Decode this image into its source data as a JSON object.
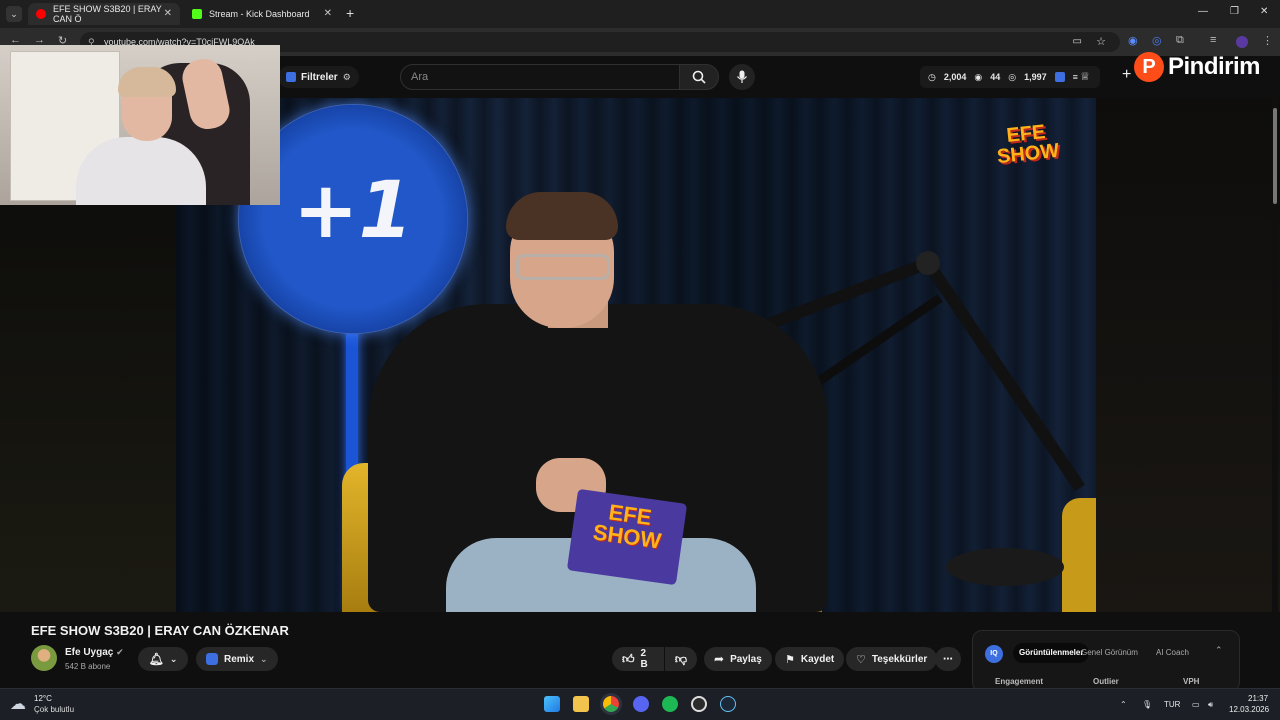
{
  "browser": {
    "tabs": [
      {
        "label": "EFE SHOW S3B20 | ERAY CAN Ö",
        "active": true,
        "color": "#ff0000"
      },
      {
        "label": "Stream - Kick Dashboard",
        "active": false,
        "color": "#53fc18"
      }
    ],
    "url": "youtube.com/watch?v=T0ciFWL9OAk"
  },
  "youtube": {
    "filters_label": "Filtreler",
    "search_placeholder": "Ara",
    "stats": {
      "views": "2,004",
      "watching": "44",
      "count": "1,997"
    },
    "pindirim_label": "Pindirim"
  },
  "video_overlay": {
    "logo_top": "EFE",
    "logo_bottom": "SHOW",
    "sign_text": "+1",
    "book_top": "EFE",
    "book_bottom": "SHOW"
  },
  "video": {
    "title": "EFE SHOW S3B20 | ERAY CAN ÖZKENAR",
    "channel": "Efe Uygaç",
    "subscribers": "542 B abone",
    "remix": "Remix",
    "likes": "2 B",
    "share": "Paylaş",
    "save": "Kaydet",
    "thanks": "Teşekkürler"
  },
  "panel": {
    "tabs": [
      "Görüntülenmeler",
      "Genel Görünüm",
      "AI Coach"
    ],
    "active_tab": "Görüntülenmeler",
    "cols": [
      "Engagement",
      "Outlier",
      "VPH"
    ]
  },
  "taskbar": {
    "temp": "12°C",
    "weather": "Çok bulutlu",
    "lang": "TUR",
    "time": "21:37",
    "date": "12.03.2026"
  }
}
